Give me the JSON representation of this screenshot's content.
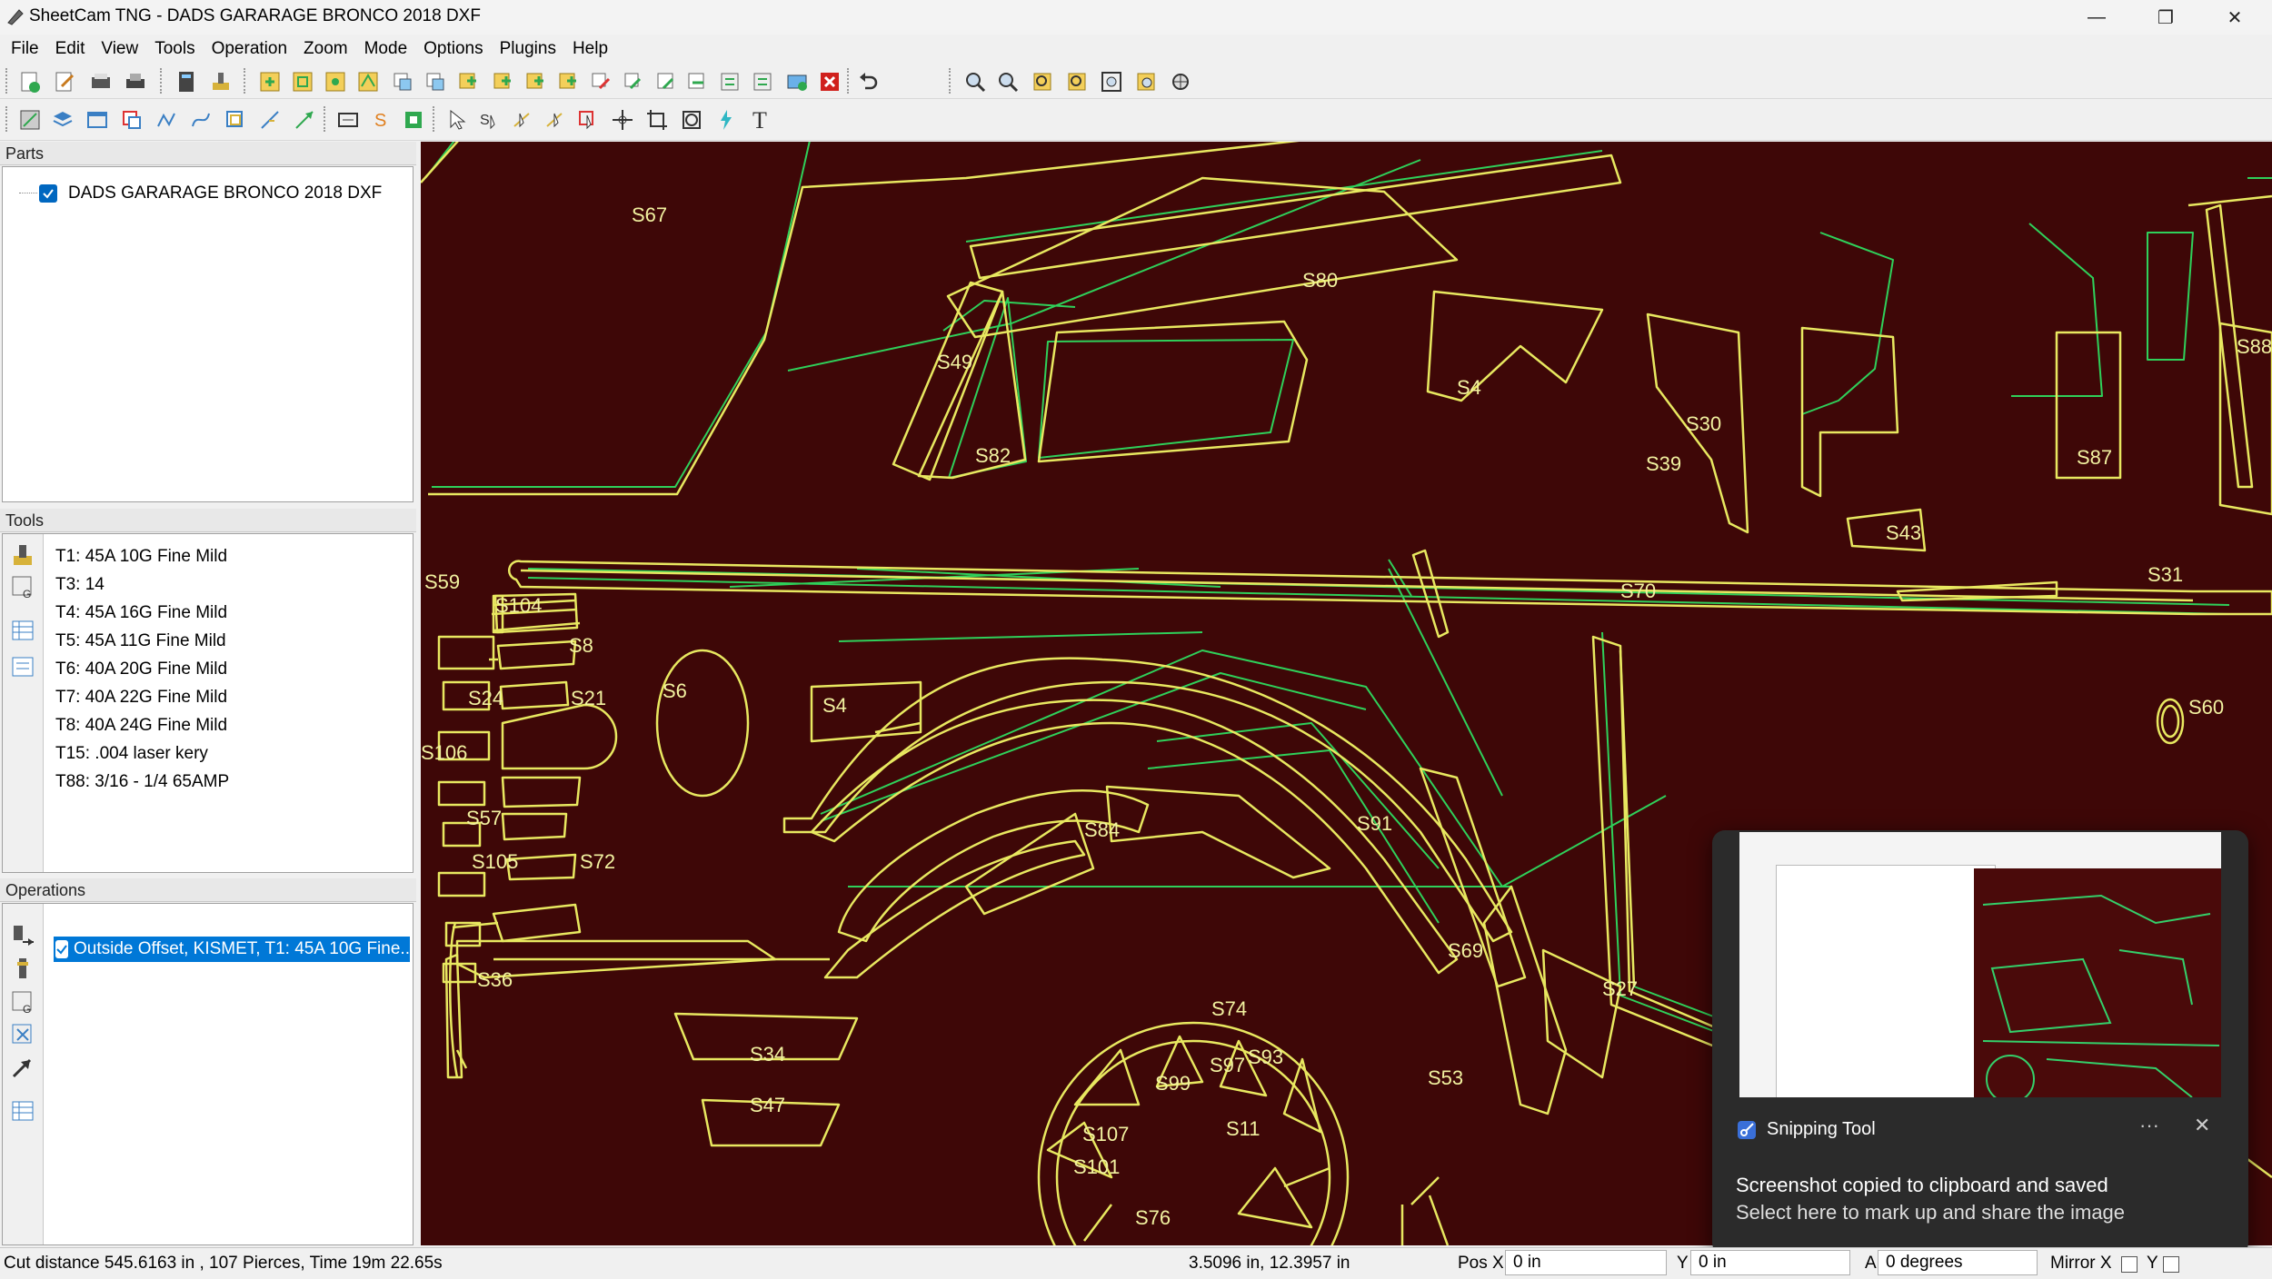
{
  "window": {
    "title": "SheetCam TNG - DADS GARARAGE BRONCO 2018 DXF",
    "minimize": "—",
    "maximize": "❐",
    "close": "✕"
  },
  "menu": [
    "File",
    "Edit",
    "View",
    "Tools",
    "Operation",
    "Zoom",
    "Mode",
    "Options",
    "Plugins",
    "Help"
  ],
  "panels": {
    "parts": {
      "title": "Parts",
      "items": [
        {
          "label": "DADS GARARAGE BRONCO 2018 DXF",
          "checked": true
        }
      ]
    },
    "tools": {
      "title": "Tools",
      "items": [
        "T1: 45A 10G Fine Mild",
        "T3: 14",
        "T4: 45A 16G Fine Mild",
        "T5: 45A 11G Fine Mild",
        "T6: 40A 20G Fine Mild",
        "T7: 40A 22G Fine Mild",
        "T8: 40A 24G Fine Mild",
        "T15: .004 laser kery",
        "T88: 3/16 - 1/4 65AMP"
      ]
    },
    "operations": {
      "title": "Operations",
      "items": [
        {
          "label": "Outside Offset, KISMET, T1: 45A 10G Fine...",
          "checked": true,
          "selected": true
        }
      ]
    }
  },
  "canvas": {
    "background": "#3e0707",
    "path_color": "#e8e860",
    "offset_color": "#2fd05a",
    "labels": [
      "S67",
      "S80",
      "S49",
      "S82",
      "S4",
      "S30",
      "S39",
      "S43",
      "S87",
      "S88",
      "S59",
      "S104",
      "S8",
      "S21",
      "S6",
      "S24",
      "S4",
      "S106",
      "S57",
      "S105",
      "S72",
      "S36",
      "S34",
      "S47",
      "S84",
      "S91",
      "S70",
      "S60",
      "S31",
      "S69",
      "S74",
      "S93",
      "S99",
      "S97",
      "S107",
      "S101",
      "S11",
      "S76",
      "S53",
      "S27"
    ]
  },
  "status": {
    "cut_info": "Cut distance 545.6163 in , 107 Pierces, Time 19m 22.65s",
    "cursor": "3.5096 in, 12.3957 in",
    "pos_x_label": "Pos X",
    "pos_x": "0 in",
    "y_label": "Y",
    "y": "0 in",
    "a_label": "A",
    "a": "0 degrees",
    "mirror_x": "Mirror X",
    "mirror_y": "Y"
  },
  "notification": {
    "app": "Snipping Tool",
    "more": "···",
    "close": "✕",
    "line1": "Screenshot copied to clipboard and saved",
    "line2": "Select here to mark up and share the image"
  }
}
